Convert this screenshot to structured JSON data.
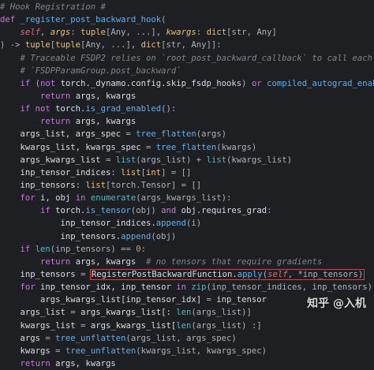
{
  "editor": {
    "lines": [
      [
        [
          "cm",
          "# Hook Registration #"
        ]
      ],
      [
        [
          "kw",
          "def "
        ],
        [
          "fn",
          "_register_post_backward_hook"
        ],
        [
          "op",
          "("
        ]
      ],
      [
        [
          "op",
          "    "
        ],
        [
          "self",
          "self"
        ],
        [
          "op",
          ", "
        ],
        [
          "prm",
          "args"
        ],
        [
          "op",
          ": "
        ],
        [
          "ty",
          "tuple"
        ],
        [
          "op",
          "[Any, ...], "
        ],
        [
          "prm",
          "kwargs"
        ],
        [
          "op",
          ": "
        ],
        [
          "ty",
          "dict"
        ],
        [
          "op",
          "[str, Any]"
        ]
      ],
      [
        [
          "op",
          ") -> "
        ],
        [
          "ty",
          "tuple"
        ],
        [
          "op",
          "["
        ],
        [
          "ty",
          "tuple"
        ],
        [
          "op",
          "[Any, ...], "
        ],
        [
          "ty",
          "dict"
        ],
        [
          "op",
          "[str, Any]]:"
        ]
      ],
      [
        [
          "cm",
          "    # Traceable FSDP2 relies on `root_post_backward_callback` to call each"
        ]
      ],
      [
        [
          "cm",
          "    # `FSDPParamGroup.post_backward`"
        ]
      ],
      [
        [
          "op",
          "    "
        ],
        [
          "kw",
          "if "
        ],
        [
          "op",
          "("
        ],
        [
          "kw",
          "not "
        ],
        [
          "id",
          "torch._dynamo.config.skip_fsdp_hooks"
        ],
        [
          "op",
          ") "
        ],
        [
          "kw",
          "or "
        ],
        [
          "fn",
          "compiled_autograd_enabled"
        ],
        [
          "op",
          "():"
        ]
      ],
      [
        [
          "op",
          "        "
        ],
        [
          "kw",
          "return "
        ],
        [
          "id",
          "args, kwargs"
        ]
      ],
      [
        [
          "op",
          "    "
        ],
        [
          "kw",
          "if not "
        ],
        [
          "id",
          "torch."
        ],
        [
          "fn",
          "is_grad_enabled"
        ],
        [
          "op",
          "():"
        ]
      ],
      [
        [
          "op",
          "        "
        ],
        [
          "kw",
          "return "
        ],
        [
          "id",
          "args, kwargs"
        ]
      ],
      [
        [
          "op",
          "    "
        ],
        [
          "id",
          "args_list, args_spec "
        ],
        [
          "op",
          "= "
        ],
        [
          "fn",
          "tree_flatten"
        ],
        [
          "op",
          "(args)"
        ]
      ],
      [
        [
          "op",
          "    "
        ],
        [
          "id",
          "kwargs_list, kwargs_spec "
        ],
        [
          "op",
          "= "
        ],
        [
          "fn",
          "tree_flatten"
        ],
        [
          "op",
          "(kwargs)"
        ]
      ],
      [
        [
          "op",
          "    "
        ],
        [
          "id",
          "args_kwargs_list "
        ],
        [
          "op",
          "= "
        ],
        [
          "bi",
          "list"
        ],
        [
          "op",
          "(args_list) + "
        ],
        [
          "bi",
          "list"
        ],
        [
          "op",
          "(kwargs_list)"
        ]
      ],
      [
        [
          "op",
          "    "
        ],
        [
          "id",
          "inp_tensor_indices"
        ],
        [
          "op",
          ": "
        ],
        [
          "ty",
          "list"
        ],
        [
          "op",
          "["
        ],
        [
          "ty",
          "int"
        ],
        [
          "op",
          "] = []"
        ]
      ],
      [
        [
          "op",
          "    "
        ],
        [
          "id",
          "inp_tensors"
        ],
        [
          "op",
          ": "
        ],
        [
          "ty",
          "list"
        ],
        [
          "op",
          "[torch.Tensor] = []"
        ]
      ],
      [
        [
          "op",
          "    "
        ],
        [
          "kw",
          "for "
        ],
        [
          "id",
          "i, obj "
        ],
        [
          "kw",
          "in "
        ],
        [
          "bi",
          "enumerate"
        ],
        [
          "op",
          "(args_kwargs_list):"
        ]
      ],
      [
        [
          "op",
          "        "
        ],
        [
          "kw",
          "if "
        ],
        [
          "id",
          "torch."
        ],
        [
          "fn",
          "is_tensor"
        ],
        [
          "op",
          "(obj) "
        ],
        [
          "kw",
          "and "
        ],
        [
          "id",
          "obj.requires_grad"
        ],
        [
          "op",
          ":"
        ]
      ],
      [
        [
          "op",
          "            "
        ],
        [
          "id",
          "inp_tensor_indices."
        ],
        [
          "fn",
          "append"
        ],
        [
          "op",
          "(i)"
        ]
      ],
      [
        [
          "op",
          "            "
        ],
        [
          "id",
          "inp_tensors."
        ],
        [
          "fn",
          "append"
        ],
        [
          "op",
          "(obj)"
        ]
      ],
      [
        [
          "op",
          "    "
        ],
        [
          "kw",
          "if "
        ],
        [
          "bi",
          "len"
        ],
        [
          "op",
          "(inp_tensors) == "
        ],
        [
          "num",
          "0"
        ],
        [
          "op",
          ":"
        ]
      ],
      [
        [
          "op",
          "        "
        ],
        [
          "kw",
          "return "
        ],
        [
          "id",
          "args, kwargs  "
        ],
        [
          "cm",
          "# no tensors that require gradients"
        ]
      ],
      [
        [
          "op",
          "    "
        ],
        [
          "id",
          "inp_tensors "
        ],
        [
          "op",
          "= "
        ],
        [
          "hl",
          ""
        ]
      ],
      [
        [
          "op",
          "    "
        ],
        [
          "kw",
          "for "
        ],
        [
          "id",
          "inp_tensor_idx, inp_tensor "
        ],
        [
          "kw",
          "in "
        ],
        [
          "bi",
          "zip"
        ],
        [
          "op",
          "(inp_tensor_indices, inp_tensors):"
        ]
      ],
      [
        [
          "op",
          "        "
        ],
        [
          "id",
          "args_kwargs_list[inp_tensor_idx] "
        ],
        [
          "op",
          "= "
        ],
        [
          "id",
          "inp_tensor"
        ]
      ],
      [
        [
          "op",
          "    "
        ],
        [
          "id",
          "args_list "
        ],
        [
          "op",
          "= "
        ],
        [
          "id",
          "args_kwargs_list[: "
        ],
        [
          "bi",
          "len"
        ],
        [
          "op",
          "(args_list)]"
        ]
      ],
      [
        [
          "op",
          "    "
        ],
        [
          "id",
          "kwargs_list "
        ],
        [
          "op",
          "= "
        ],
        [
          "id",
          "args_kwargs_list["
        ],
        [
          "bi",
          "len"
        ],
        [
          "op",
          "(args_list) :]"
        ]
      ],
      [
        [
          "op",
          "    "
        ],
        [
          "id",
          "args "
        ],
        [
          "op",
          "= "
        ],
        [
          "fn",
          "tree_unflatten"
        ],
        [
          "op",
          "(args_list, args_spec)"
        ]
      ],
      [
        [
          "op",
          "    "
        ],
        [
          "id",
          "kwargs "
        ],
        [
          "op",
          "= "
        ],
        [
          "fn",
          "tree_unflatten"
        ],
        [
          "op",
          "(kwargs_list, kwargs_spec)"
        ]
      ],
      [
        [
          "op",
          "    "
        ],
        [
          "kw",
          "return "
        ],
        [
          "id",
          "args, kwargs"
        ]
      ]
    ],
    "highlight_segments": [
      [
        "id",
        "RegisterPostBackwardFunction."
      ],
      [
        "fn",
        "apply"
      ],
      [
        "op",
        "("
      ],
      [
        "self",
        "self"
      ],
      [
        "op",
        ", *inp_tensors)"
      ]
    ]
  },
  "watermark": "知乎 @入机",
  "colors": {
    "background": "#1e1f22",
    "highlight_box": "#e03c3c",
    "keyword": "#c678dd",
    "function": "#61afef",
    "comment": "#7f848e"
  }
}
